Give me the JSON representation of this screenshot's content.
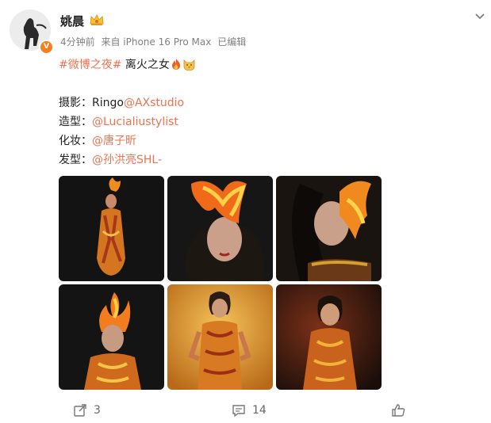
{
  "post": {
    "username": "姚晨",
    "time": "4分钟前",
    "source": "来自 iPhone 16 Pro Max",
    "edited": "已编辑",
    "hashtag": "#微博之夜#",
    "caption": " 离火之女",
    "credits": [
      {
        "label": "摄影：",
        "name": "Ringo",
        "link": "@AXstudio"
      },
      {
        "label": "造型：",
        "name": "",
        "link": "@Lucialiustylist"
      },
      {
        "label": "化妆：",
        "name": "",
        "link": "@唐子昕"
      },
      {
        "label": "发型：",
        "name": "",
        "link": "@孙洪亮SHL-"
      }
    ]
  },
  "actions": {
    "share_count": "3",
    "comment_count": "14"
  },
  "icons": {
    "verified": "verified-badge-icon",
    "crown": "crown-icon",
    "more": "chevron-down-icon",
    "fire": "fire-emoji-icon",
    "cat": "cat-emoji-icon",
    "share": "share-icon",
    "comment": "comment-icon",
    "like": "like-icon"
  },
  "colors": {
    "link": "#eb7350",
    "verified": "#f77e1b",
    "meta": "#808080"
  }
}
